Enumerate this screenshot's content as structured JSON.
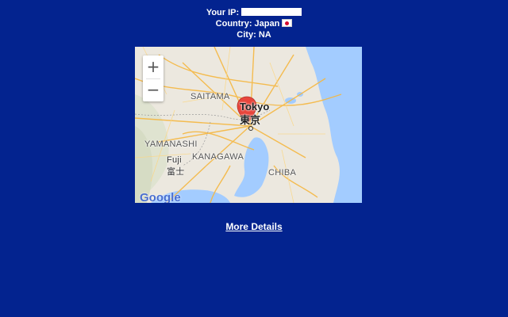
{
  "info": {
    "ip_label": "Your IP:",
    "country_label": "Country:",
    "country_value": "Japan",
    "city_label": "City:",
    "city_value": "NA"
  },
  "map": {
    "zoom_in": "+",
    "zoom_out": "−",
    "labels": {
      "saitama": "SAITAMA",
      "tokyo_en": "Tokyo",
      "tokyo_jp": "東京",
      "yamanashi": "YAMANASHI",
      "kanagawa": "KANAGAWA",
      "fuji_en": "Fuji",
      "fuji_jp": "富士",
      "chiba": "CHIBA"
    },
    "attribution": "Google"
  },
  "links": {
    "more_details": "More Details"
  },
  "colors": {
    "background": "#03238f",
    "marker": "#e8453c",
    "water": "#a3ccff",
    "road": "#f5b740"
  }
}
